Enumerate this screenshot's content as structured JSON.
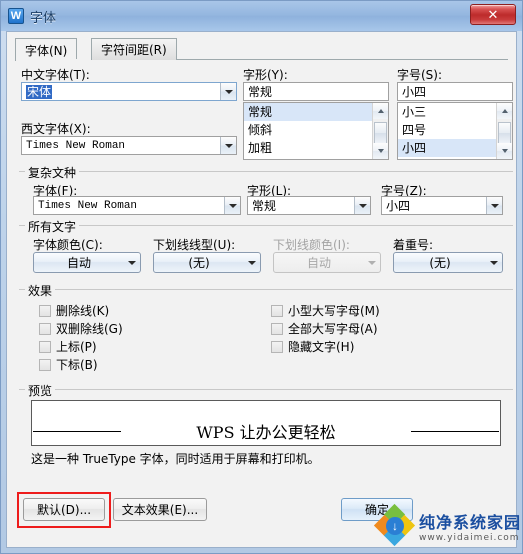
{
  "window": {
    "title": "字体",
    "icon": "wps-logo-icon",
    "close_label": "✕"
  },
  "tabs": [
    {
      "label": "字体(N)",
      "active": true
    },
    {
      "label": "字符间距(R)",
      "active": false
    }
  ],
  "latin_section": {
    "chinese_font_label": "中文字体(T):",
    "chinese_font_value": "宋体",
    "western_font_label": "西文字体(X):",
    "western_font_value": "Times New Roman",
    "style_label": "字形(Y):",
    "style_value": "常规",
    "style_options": [
      "常规",
      "倾斜",
      "加粗"
    ],
    "style_selected_index": 0,
    "size_label": "字号(S):",
    "size_value": "小四",
    "size_options": [
      "小三",
      "四号",
      "小四"
    ],
    "size_selected_index": 2
  },
  "complex_section": {
    "title": "复杂文种",
    "font_label": "字体(F):",
    "font_value": "Times New Roman",
    "style_label": "字形(L):",
    "style_value": "常规",
    "size_label": "字号(Z):",
    "size_value": "小四"
  },
  "alltext_section": {
    "title": "所有文字",
    "font_color_label": "字体颜色(C):",
    "font_color_value": "自动",
    "underline_style_label": "下划线线型(U):",
    "underline_style_value": "(无)",
    "underline_color_label": "下划线颜色(I):",
    "underline_color_value": "自动",
    "underline_color_disabled": true,
    "emphasis_label": "着重号:",
    "emphasis_value": "(无)"
  },
  "effects_section": {
    "title": "效果",
    "left_column": [
      {
        "label": "删除线(K)",
        "checked": false
      },
      {
        "label": "双删除线(G)",
        "checked": false
      },
      {
        "label": "上标(P)",
        "checked": false
      },
      {
        "label": "下标(B)",
        "checked": false
      }
    ],
    "right_column": [
      {
        "label": "小型大写字母(M)",
        "checked": false
      },
      {
        "label": "全部大写字母(A)",
        "checked": false
      },
      {
        "label": "隐藏文字(H)",
        "checked": false
      }
    ]
  },
  "preview_section": {
    "title": "预览",
    "sample_text": "WPS 让办公更轻松",
    "note": "这是一种 TrueType 字体，同时适用于屏幕和打印机。"
  },
  "footer": {
    "default_button": "默认(D)...",
    "text_effects_button": "文本效果(E)...",
    "ok_button": "确定"
  },
  "watermark": {
    "name": "纯净系统家园",
    "url": "www.yidaimei.com",
    "glyph": "↓"
  },
  "colors": {
    "titlebar": "#95b7e0",
    "close_red": "#bd2b2b",
    "selection_blue": "#316ac5",
    "list_selection": "#d8e6f8",
    "annotation_red": "#ee1c1c",
    "watermark_blue": "#1b4fa0"
  }
}
